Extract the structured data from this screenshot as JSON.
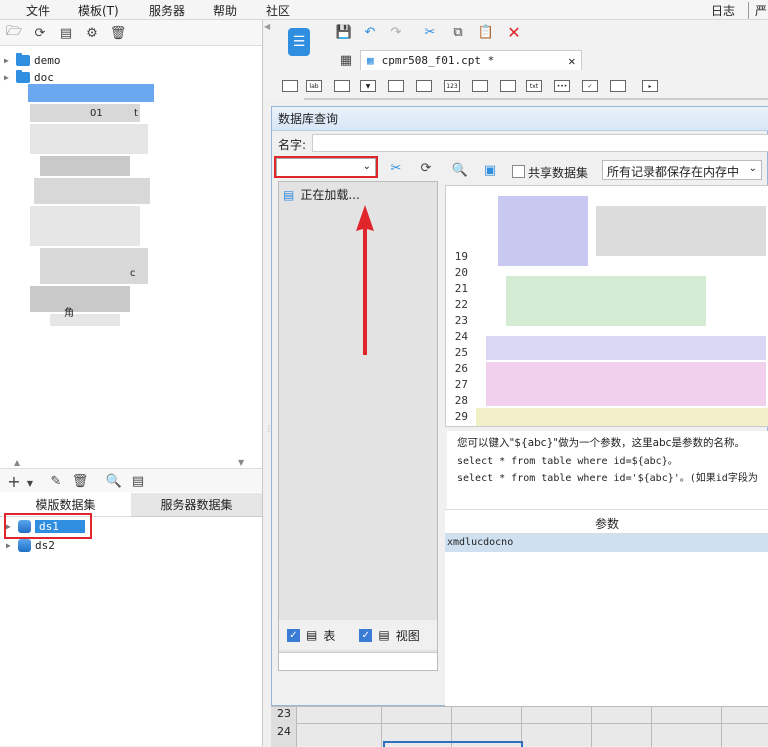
{
  "menubar": {
    "items": [
      "文件",
      "模板(T)",
      "服务器",
      "帮助",
      "社区"
    ],
    "right_items": [
      "日志",
      "严"
    ]
  },
  "tree": {
    "items": [
      {
        "label": "demo"
      },
      {
        "label": "doc"
      }
    ],
    "fragments": [
      "01",
      "t",
      "c",
      "角"
    ]
  },
  "datasets": {
    "tabs": [
      "模版数据集",
      "服务器数据集"
    ],
    "items": [
      "ds1",
      "ds2"
    ]
  },
  "editor": {
    "tab_label": "cpmr508_f01.cpt *"
  },
  "dialog": {
    "title": "数据库查询",
    "name_label": "名字:",
    "shared_dataset_label": "共享数据集",
    "memory_select": "所有记录都保存在内存中",
    "loading_text": "正在加载...",
    "line_numbers": [
      "19",
      "20",
      "21",
      "22",
      "23",
      "24",
      "25",
      "26",
      "27",
      "28",
      "29"
    ],
    "hint_line1": "您可以键入\"${abc}\"做为一个参数，这里abc是参数的名称。",
    "hint_line2": "select * from table where id=${abc}。",
    "hint_line3": "select * from table where id='${abc}'。(如果id字段为",
    "param_header": "参数",
    "param_row": "xmdlucdocno",
    "table_checkbox_label": "表",
    "view_checkbox_label": "视图"
  },
  "sheet": {
    "rows": [
      "23",
      "24"
    ]
  },
  "colors": {
    "accent": "#2f8ee0",
    "highlight_red": "#e0262b"
  }
}
